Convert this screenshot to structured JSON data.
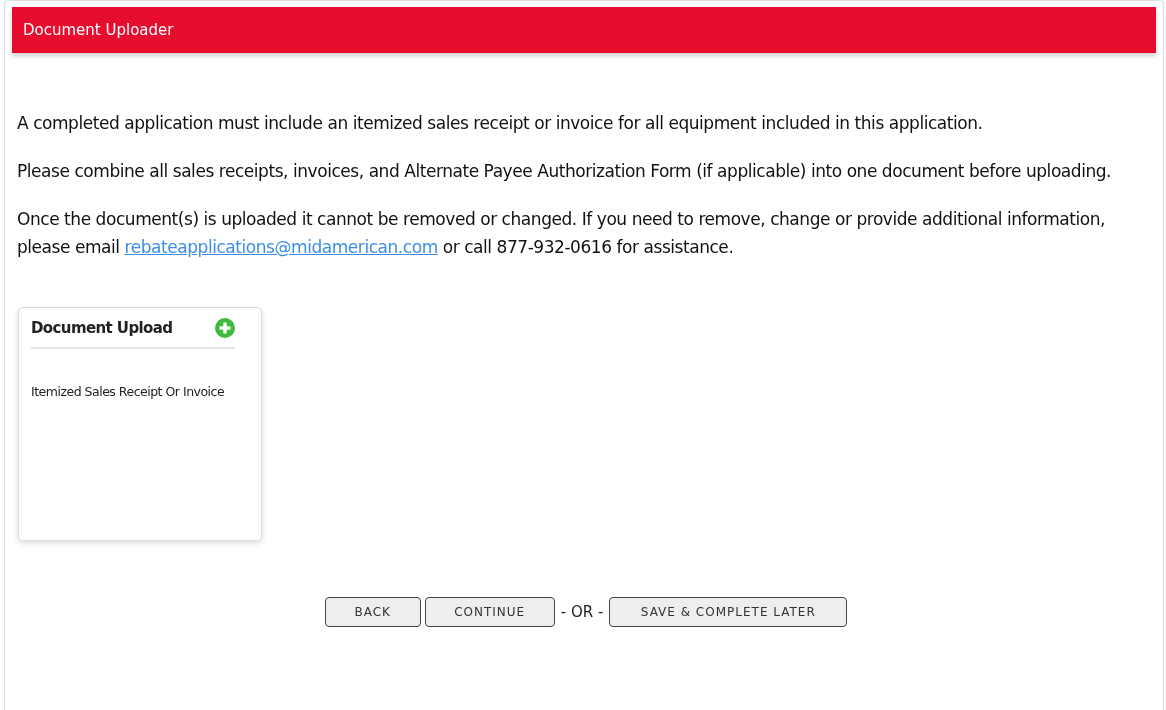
{
  "header": {
    "title": "Document Uploader"
  },
  "paragraphs": [
    {
      "text": "A completed application must include an itemized sales receipt or invoice for all equipment included in this application."
    },
    {
      "text": "Please combine all sales receipts, invoices, and Alternate Payee Authorization Form (if applicable) into one document before uploading."
    },
    {
      "text": "Once the document(s) is uploaded it cannot be removed or changed. If you need to remove, change or provide additional information, please email ",
      "link": "rebateapplications@midamerican.com",
      "after": " or call 877-932-0616 for assistance."
    }
  ],
  "upload_card": {
    "title": "Document Upload",
    "items": [
      "Itemized Sales Receipt Or Invoice"
    ]
  },
  "buttons": [
    {
      "label": "BACK"
    },
    {
      "label": "CONTINUE"
    }
  ],
  "separator": "- OR -",
  "save_button": {
    "label": "SAVE & COMPLETE LATER"
  }
}
